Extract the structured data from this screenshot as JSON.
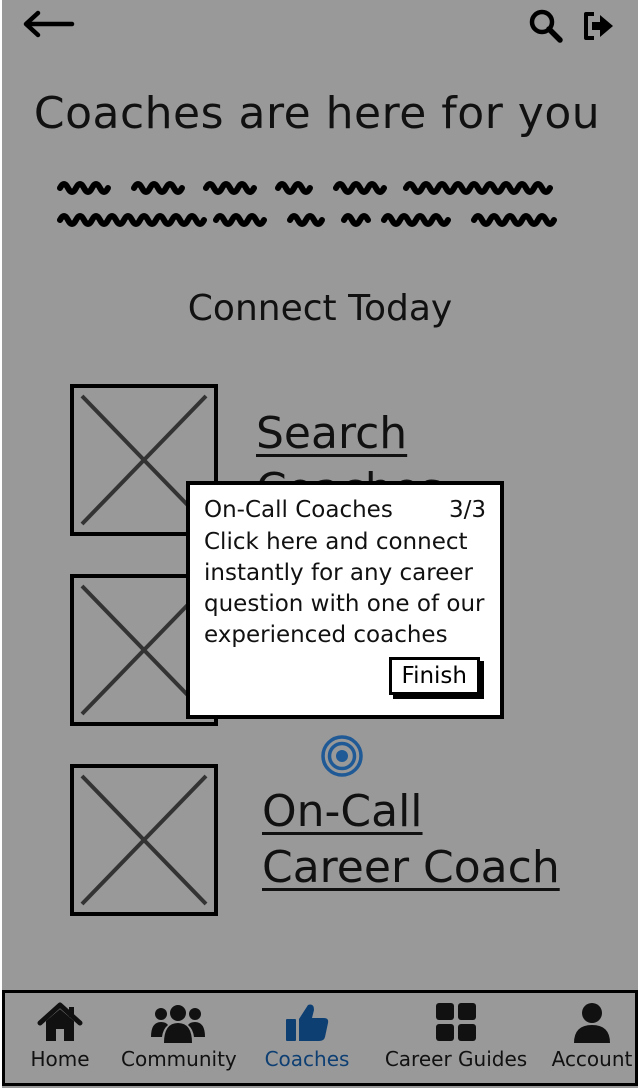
{
  "header": {
    "back_icon": "arrow-left-icon",
    "search_icon": "search-icon",
    "logout_icon": "sign-out-icon"
  },
  "page": {
    "title": "Coaches are here for you",
    "section_title": "Connect Today"
  },
  "options": [
    {
      "label": "Search Coaches",
      "icon": "image-placeholder"
    },
    {
      "label": "",
      "icon": "image-placeholder"
    },
    {
      "label_line1": "On-Call",
      "label_line2": "Career Coach",
      "icon": "image-placeholder"
    }
  ],
  "tooltip": {
    "title": "On-Call Coaches",
    "step": "3/3",
    "body": "Click here and connect instantly for any career question with one of our experienced coaches",
    "finish_label": "Finish"
  },
  "hotspot": {
    "icon": "target-icon",
    "color": "#1f5a96"
  },
  "nav": {
    "active_color": "#0e3f73",
    "items": [
      {
        "label": "Home",
        "icon": "home-icon"
      },
      {
        "label": "Community",
        "icon": "users-icon"
      },
      {
        "label": "Coaches",
        "icon": "thumbs-up-icon",
        "active": true
      },
      {
        "label": "Career Guides",
        "icon": "grid-icon"
      },
      {
        "label": "Account",
        "icon": "user-icon"
      }
    ]
  }
}
